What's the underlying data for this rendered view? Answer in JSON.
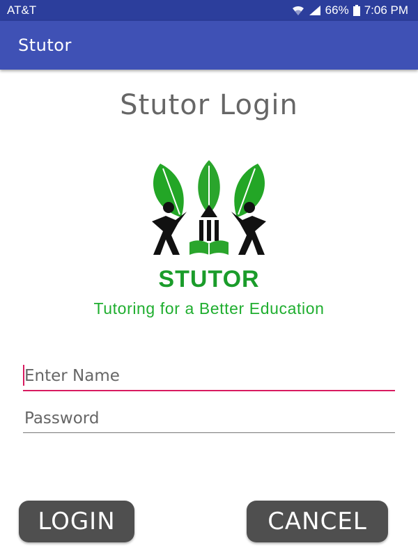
{
  "status_bar": {
    "carrier": "AT&T",
    "battery_percent": "66%",
    "time": "7:06 PM",
    "icons": [
      "wifi-icon",
      "signal-icon",
      "battery-icon"
    ]
  },
  "app_bar": {
    "title": "Stutor"
  },
  "page": {
    "heading": "Stutor Login"
  },
  "logo": {
    "wordmark": "STUTOR",
    "tagline": "Tutoring for a Better Education",
    "icon": "stutor-logo-icon"
  },
  "form": {
    "name_placeholder": "Enter Name",
    "name_value": "",
    "password_placeholder": "Password",
    "password_value": ""
  },
  "buttons": {
    "login": "LOGIN",
    "cancel": "CANCEL"
  },
  "colors": {
    "status_bar": "#2c3e9c",
    "app_bar": "#3f51b5",
    "accent": "#d81b60",
    "logo_green": "#1a9c2a",
    "button_bg": "#4f4f4f"
  }
}
